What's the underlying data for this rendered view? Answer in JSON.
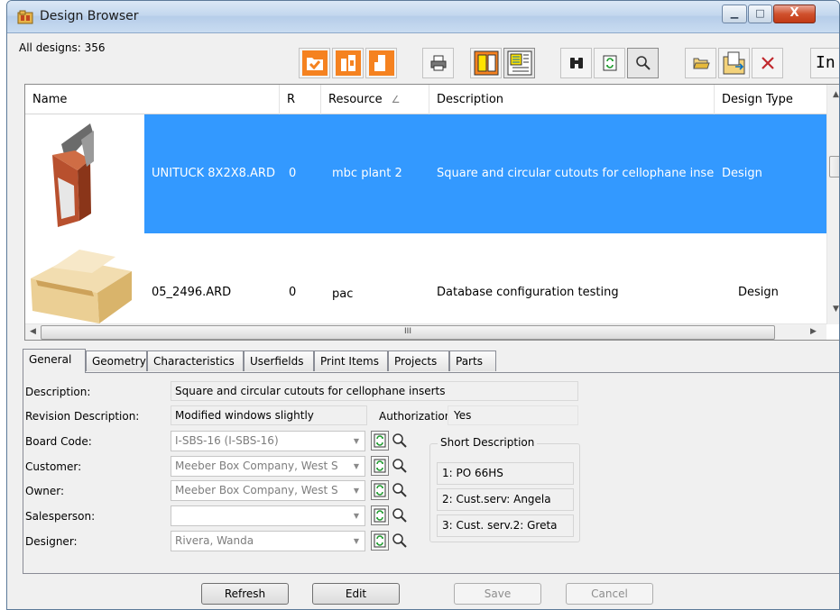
{
  "window": {
    "title": "Design Browser",
    "controls": {
      "minimize": "▁",
      "maximize": "□",
      "close": "X"
    }
  },
  "toolbar": {
    "count_label": "All designs: 356",
    "text_button": "In",
    "icons": [
      "folder-open-orange-icon",
      "design-orange-icon",
      "design-alt-orange-icon",
      "print-icon",
      "layout-icon",
      "database-icon",
      "binoculars-icon",
      "refresh-icon",
      "search-icon",
      "open-folder-icon",
      "export-folder-icon",
      "delete-icon"
    ]
  },
  "grid": {
    "columns": [
      "Name",
      "R",
      "Resource",
      "Description",
      "Design Type"
    ],
    "sort_indicator": "∠",
    "rows": [
      {
        "name": "UNITUCK 8X2X8.ARD",
        "revision": "0",
        "resource": "mbc plant 2",
        "description": "Square and circular cutouts for cellophane inse",
        "design_type": "Design",
        "selected": true
      },
      {
        "name": "05_2496.ARD",
        "revision": "0",
        "resource": "pac",
        "description": "Database configuration testing",
        "design_type": "Design",
        "selected": false
      }
    ],
    "hscroll_grip": "III"
  },
  "tabs": [
    "General",
    "Geometry",
    "Characteristics",
    "Userfields",
    "Print Items",
    "Projects",
    "Parts"
  ],
  "active_tab": "General",
  "general": {
    "description_label": "Description:",
    "description_value": "Square and circular cutouts for cellophane inserts",
    "revision_label": "Revision Description:",
    "revision_value": "Modified windows slightly",
    "authorization_label": "Authorization:",
    "authorization_value": "Yes",
    "board_code_label": "Board Code:",
    "board_code_value": "I-SBS-16 (I-SBS-16)",
    "customer_label": "Customer:",
    "customer_value": "Meeber Box Company, West S",
    "owner_label": "Owner:",
    "owner_value": "Meeber Box Company, West S",
    "salesperson_label": "Salesperson:",
    "salesperson_value": "",
    "designer_label": "Designer:",
    "designer_value": "Rivera, Wanda",
    "short_desc_title": "Short Description",
    "short_desc": [
      "1:  PO 66HS",
      "2:  Cust.serv: Angela",
      "3:  Cust. serv.2: Greta"
    ]
  },
  "buttons": {
    "refresh": "Refresh",
    "edit": "Edit",
    "save": "Save",
    "cancel": "Cancel"
  },
  "colors": {
    "selection": "#3399ff",
    "accent_orange": "#f58220"
  }
}
